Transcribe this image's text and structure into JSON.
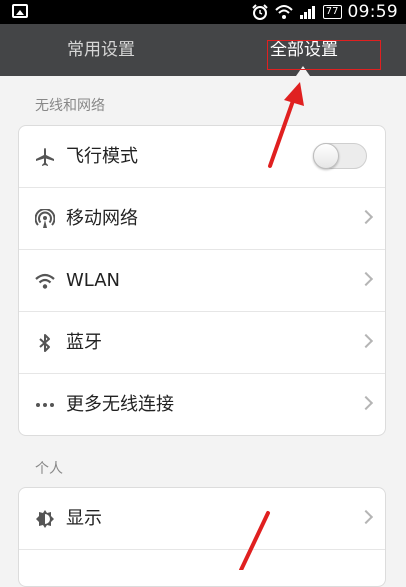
{
  "status_bar": {
    "time": "09:59",
    "battery": "77",
    "icons": [
      "image-icon",
      "alarm-icon",
      "wifi-icon",
      "signal-icon",
      "battery-icon"
    ]
  },
  "tabs": [
    {
      "label": "常用设置",
      "selected": false
    },
    {
      "label": "全部设置",
      "selected": true
    }
  ],
  "sections": [
    {
      "title": "无线和网络",
      "items": [
        {
          "label": "飞行模式",
          "icon": "airplane-icon",
          "control": "toggle",
          "toggle_on": false
        },
        {
          "label": "移动网络",
          "icon": "mobile-network-icon",
          "control": "chevron"
        },
        {
          "label": "WLAN",
          "icon": "wifi-icon",
          "control": "chevron"
        },
        {
          "label": "蓝牙",
          "icon": "bluetooth-icon",
          "control": "chevron"
        },
        {
          "label": "更多无线连接",
          "icon": "more-icon",
          "control": "chevron"
        }
      ]
    },
    {
      "title": "个人",
      "items": [
        {
          "label": "显示",
          "icon": "display-gear-icon",
          "control": "chevron"
        }
      ]
    }
  ],
  "annotation_color": "#e02020"
}
